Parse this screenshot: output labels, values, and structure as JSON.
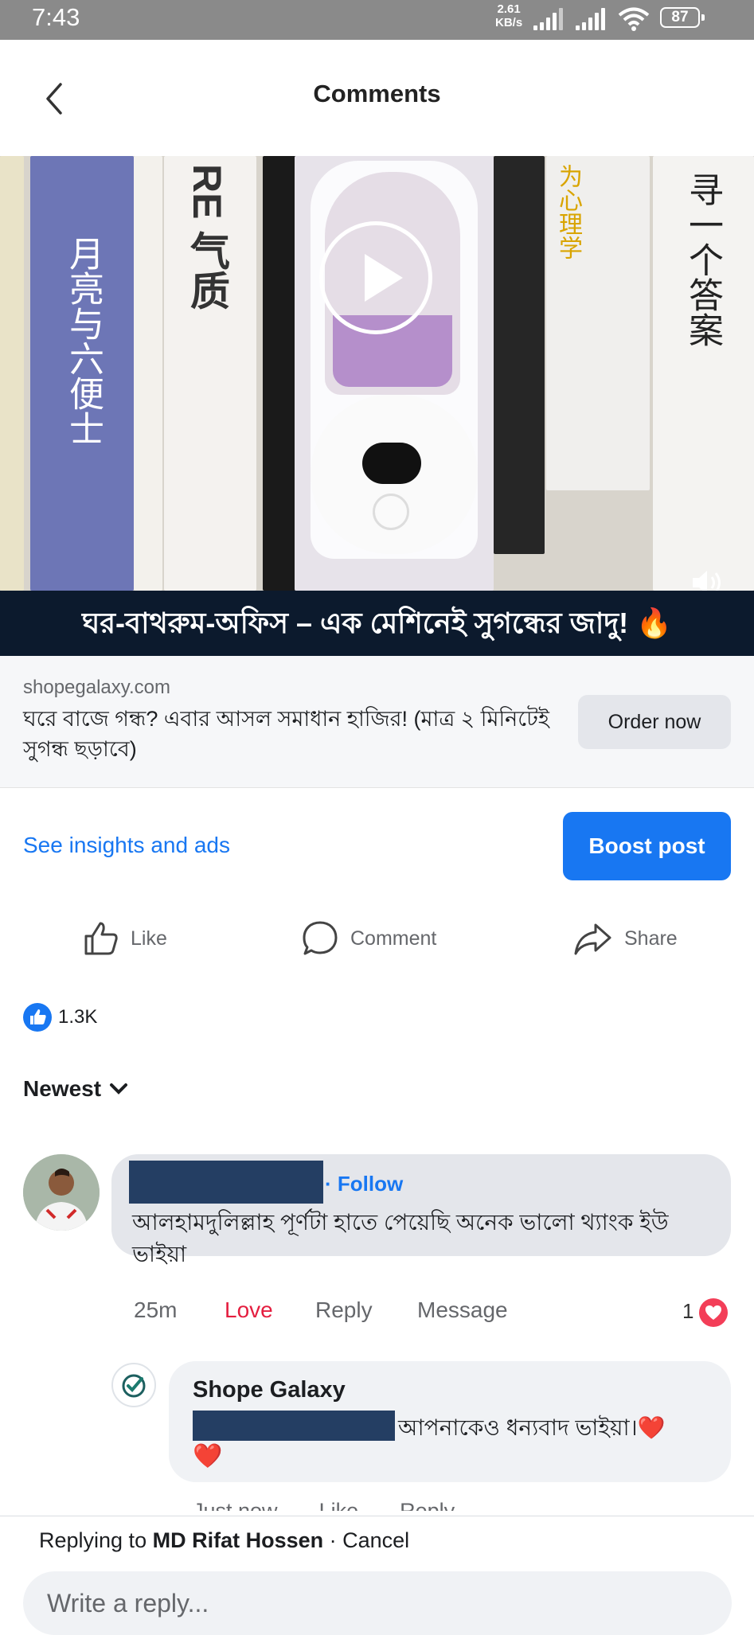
{
  "status_bar": {
    "time": "7:43",
    "net_rate_top": "2.61",
    "net_rate_bottom": "KB/s",
    "battery": "87",
    "icons": [
      "signal-icon",
      "signal-icon",
      "wifi-icon",
      "battery-icon"
    ]
  },
  "header": {
    "title": "Comments",
    "back_icon": "chevron-left-icon"
  },
  "post": {
    "video_caption": "ঘর-বাথরুম-অফিস – এক মেশিনেই সুগন্ধের জাদু! 🔥",
    "book_texts": {
      "book1": "月亮与六便士",
      "book2": "RE 气质",
      "book3": "寻一个答案",
      "book4": "为心理学"
    },
    "link": {
      "domain": "shopegalaxy.com",
      "text": "ঘরে বাজে গন্ধ? এবার আসল সমাধান হাজির! (মাত্র ২ মিনিটেই সুগন্ধ ছড়াবে)",
      "cta": "Order now"
    },
    "insights_link": "See insights and ads",
    "boost_button": "Boost post",
    "actions": {
      "like": "Like",
      "comment": "Comment",
      "share": "Share"
    },
    "reaction_count": "1.3K"
  },
  "comments": {
    "sort_label": "Newest",
    "items": [
      {
        "follow": "· Follow",
        "text": "আলহামদুলিল্লাহ পূর্ণটা হাতে পেয়েছি অনেক ভালো থ্যাংক ইউ ভাইয়া",
        "time": "25m",
        "love": "Love",
        "reply": "Reply",
        "message": "Message",
        "reaction_count": "1"
      }
    ],
    "reply": {
      "author": "Shope Galaxy",
      "text": "আপনাকেও ধন্যবাদ ভাইয়া।❤️",
      "heart": "❤️",
      "time": "Just now",
      "like": "Like",
      "reply": "Reply"
    }
  },
  "reply_bar": {
    "prefix": "Replying to ",
    "name": "MD Rifat Hossen",
    "separator": " · ",
    "cancel": "Cancel",
    "placeholder": "Write a reply..."
  },
  "colors": {
    "accent": "#1877f2",
    "love": "#e41e3f",
    "caption_bg": "#0c1a2d",
    "redaction": "#243e63"
  }
}
